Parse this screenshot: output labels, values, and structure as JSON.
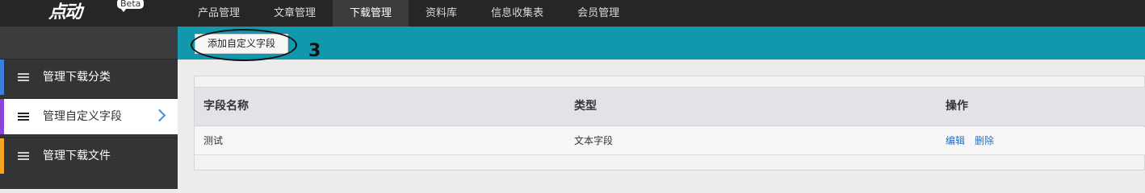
{
  "brand": {
    "logo_text": "点动",
    "badge": "Beta"
  },
  "nav": {
    "items": [
      "产品管理",
      "文章管理",
      "下载管理",
      "资料库",
      "信息收集表",
      "会员管理"
    ],
    "active_index": 2
  },
  "sidebar": {
    "items": [
      {
        "label": "管理下载分类",
        "accent": "#3a7fdc"
      },
      {
        "label": "管理自定义字段",
        "accent": "#8e44d8",
        "active": true
      },
      {
        "label": "管理下载文件",
        "accent": "#f5a623"
      }
    ]
  },
  "toolbar": {
    "add_button": "添加自定义字段",
    "step_number": "3",
    "banner_color": "#1298ad"
  },
  "table": {
    "columns": [
      "字段名称",
      "类型",
      "操作"
    ],
    "rows": [
      {
        "name": "测试",
        "type": "文本字段",
        "actions": [
          "编辑",
          "删除"
        ]
      }
    ]
  }
}
